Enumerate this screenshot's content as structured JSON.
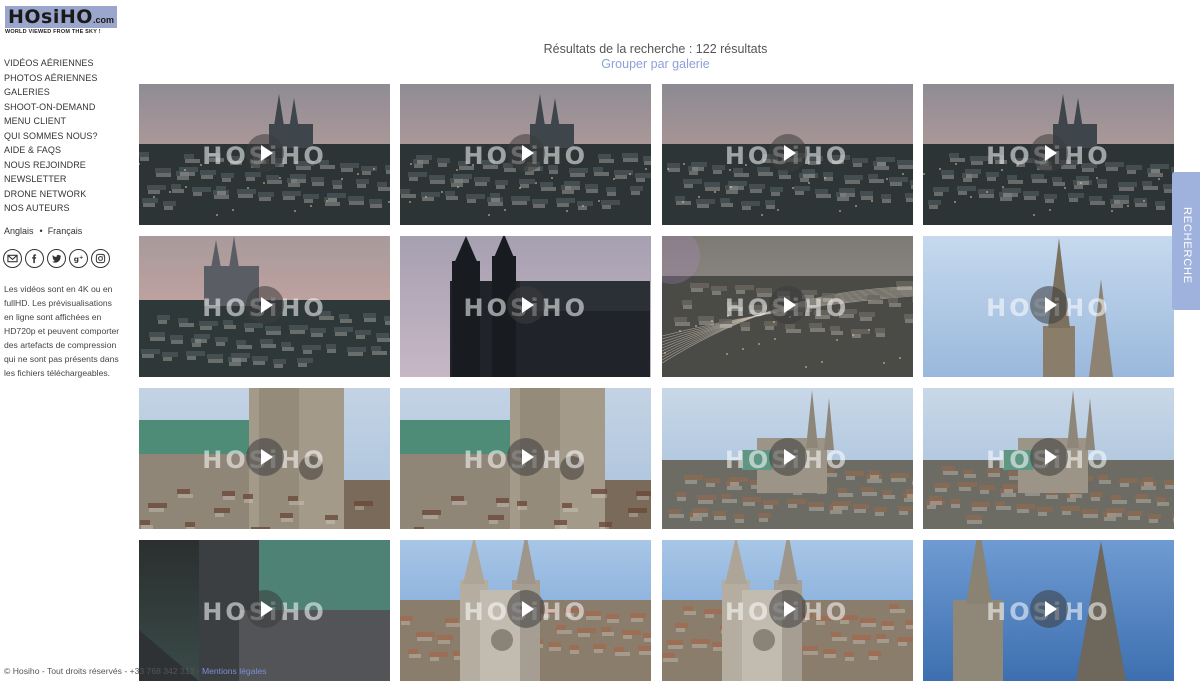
{
  "logo": {
    "main": "HOsiHO",
    "suffix": ".com",
    "tagline": "WORLD VIEWED FROM THE SKY !"
  },
  "nav": [
    "VIDÉOS AÉRIENNES",
    "PHOTOS AÉRIENNES",
    "GALERIES",
    "SHOOT-ON-DEMAND",
    "MENU CLIENT",
    "QUI SOMMES NOUS?",
    "AIDE & FAQS",
    "NOUS REJOINDRE",
    "NEWSLETTER",
    "DRONE NETWORK",
    "NOS AUTEURS"
  ],
  "languages": {
    "en": "Anglais",
    "sep": "•",
    "fr": "Français"
  },
  "socials": [
    "email-icon",
    "facebook-icon",
    "twitter-icon",
    "google-plus-icon",
    "instagram-icon"
  ],
  "notice": "Les vidéos sont en 4K ou en fullHD. Les prévisualisations en ligne sont affichées en HD720p et peuvent comporter des artefacts de compression qui ne sont pas présents dans les fichiers téléchargeables.",
  "header": {
    "results": "Résultats de la recherche : 122 résultats",
    "group_link": "Grouper par galerie"
  },
  "watermark": "HOSiHO",
  "search_tab": "RECHERCHE",
  "footer": {
    "text": "© Hosiho - Tout droits réservés - +33 768 342 313 - ",
    "link": "Mentions légales"
  },
  "colors": {
    "accent": "#8ea0d8",
    "tab": "#9fb1dd",
    "logo_bg": "#9aa6cc"
  },
  "tiles": [
    {
      "scene": "dusk-city-cathedral"
    },
    {
      "scene": "dusk-city-cathedral"
    },
    {
      "scene": "dusk-city"
    },
    {
      "scene": "dusk-city-cathedral"
    },
    {
      "scene": "dusk-cathedral-close"
    },
    {
      "scene": "silhouette-cathedral"
    },
    {
      "scene": "rail-yard"
    },
    {
      "scene": "spires-blue-sky"
    },
    {
      "scene": "cathedral-facade"
    },
    {
      "scene": "cathedral-facade"
    },
    {
      "scene": "cathedral-daylight"
    },
    {
      "scene": "cathedral-daylight"
    },
    {
      "scene": "cathedral-roof-shadow"
    },
    {
      "scene": "cathedral-towers-top"
    },
    {
      "scene": "cathedral-towers-top"
    },
    {
      "scene": "spires-close-blue"
    }
  ]
}
